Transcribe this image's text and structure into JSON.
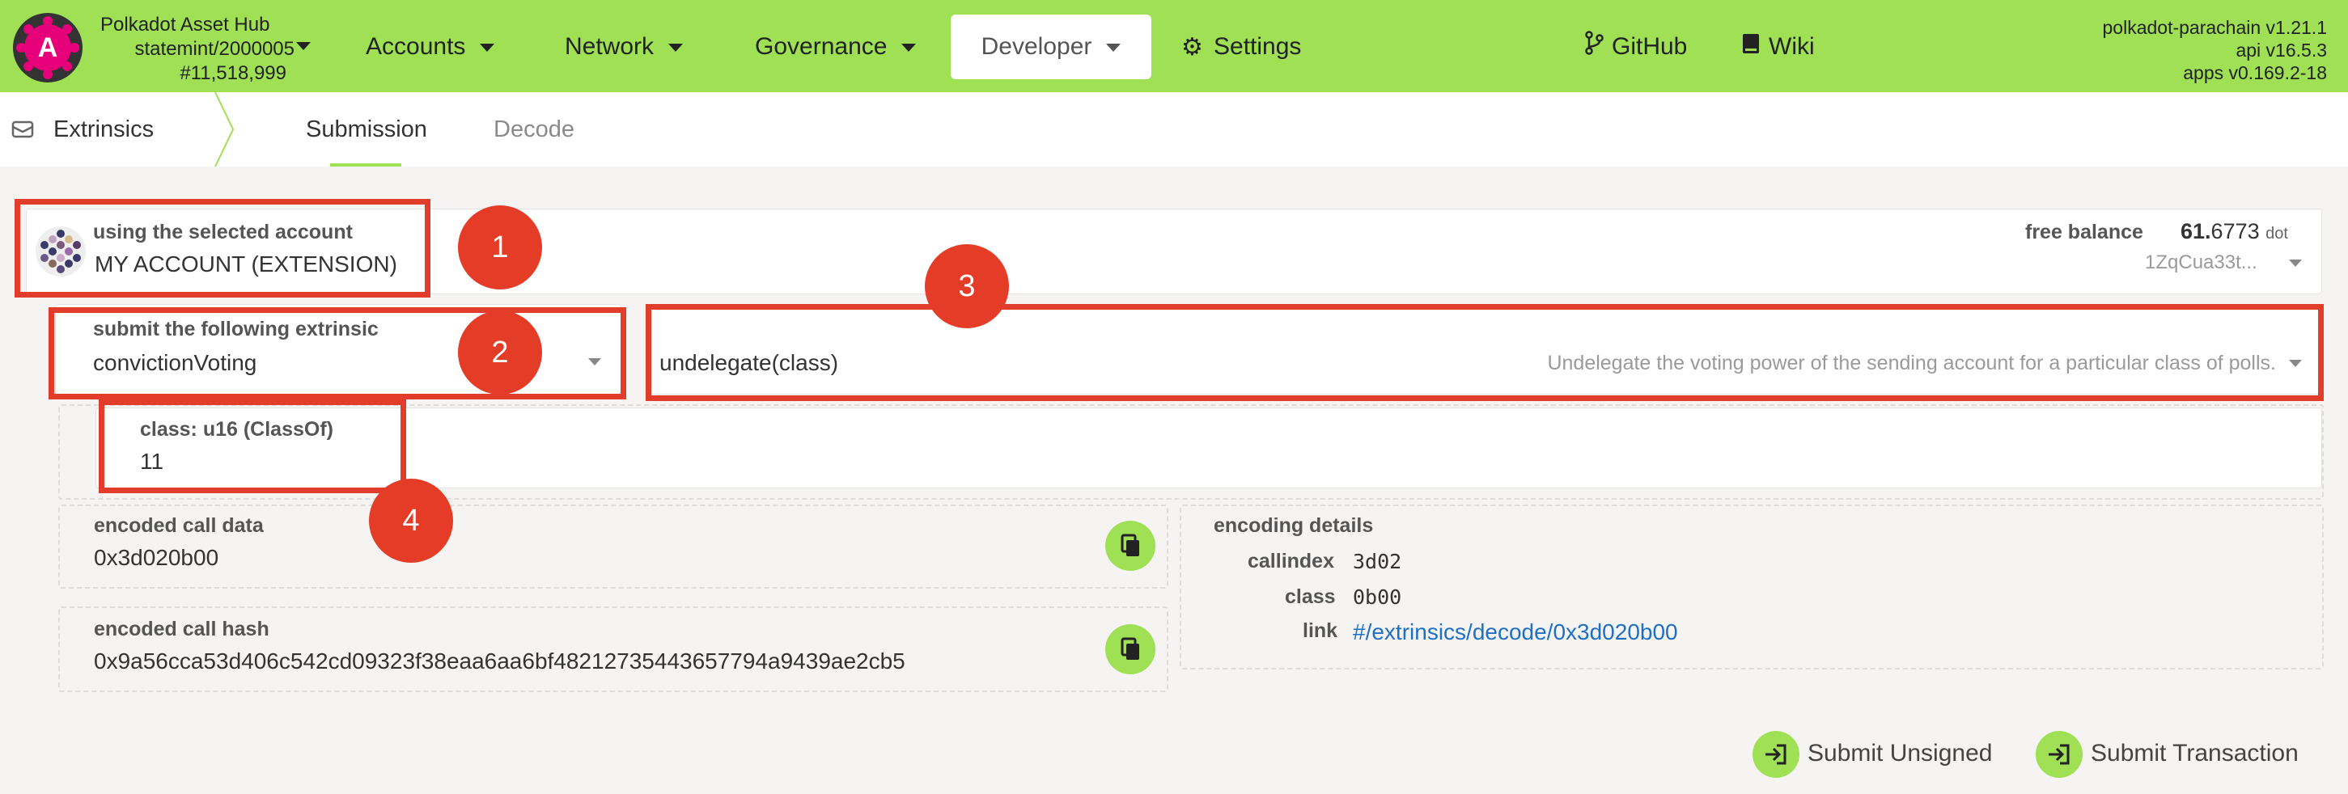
{
  "colors": {
    "nav_bg": "#9fe055",
    "annotation_red": "#e23d2b",
    "link_blue": "#1f6fc4"
  },
  "chain": {
    "name": "Polkadot Asset Hub",
    "id": "statemint/2000005",
    "block": "#11,518,999",
    "logo_letter": "A"
  },
  "nav": {
    "accounts": "Accounts",
    "network": "Network",
    "governance": "Governance",
    "developer": "Developer",
    "settings": "Settings",
    "github": "GitHub",
    "wiki": "Wiki"
  },
  "version": {
    "line1": "polkadot-parachain v1.21.1",
    "line2": "api v16.5.3",
    "line3": "apps v0.169.2-18"
  },
  "subnav": {
    "section": "Extrinsics",
    "tabs": [
      "Submission",
      "Decode"
    ]
  },
  "account": {
    "label": "using the selected account",
    "name": "MY ACCOUNT (EXTENSION)",
    "balance_label": "free balance",
    "balance_int": "61.",
    "balance_dec": "6773",
    "balance_unit": "dot",
    "address": "1ZqCua33t..."
  },
  "extrinsic": {
    "label": "submit the following extrinsic",
    "module": "convictionVoting",
    "method": "undelegate(class)",
    "description": "Undelegate the voting power of the sending account for a particular class of polls."
  },
  "param": {
    "label": "class: u16 (ClassOf)",
    "value": "11"
  },
  "encoded": {
    "call_data_label": "encoded call data",
    "call_data": "0x3d020b00",
    "call_hash_label": "encoded call hash",
    "call_hash": "0x9a56cca53d406c542cd09323f38eaa6aa6bf48212735443657794a9439ae2cb5"
  },
  "encoding_details": {
    "title": "encoding details",
    "callindex_label": "callindex",
    "callindex": "3d02",
    "class_label": "class",
    "class": "0b00",
    "link_label": "link",
    "link": "#/extrinsics/decode/0x3d020b00"
  },
  "annotations": [
    "1",
    "2",
    "3",
    "4"
  ],
  "buttons": {
    "submit_unsigned": "Submit Unsigned",
    "submit_transaction": "Submit Transaction"
  },
  "icons": {
    "logo": "polkadot-logo-icon",
    "gear": "gear-icon",
    "github": "git-branch-icon",
    "wiki": "book-icon",
    "copy": "copy-icon",
    "submit": "sign-in-icon"
  }
}
